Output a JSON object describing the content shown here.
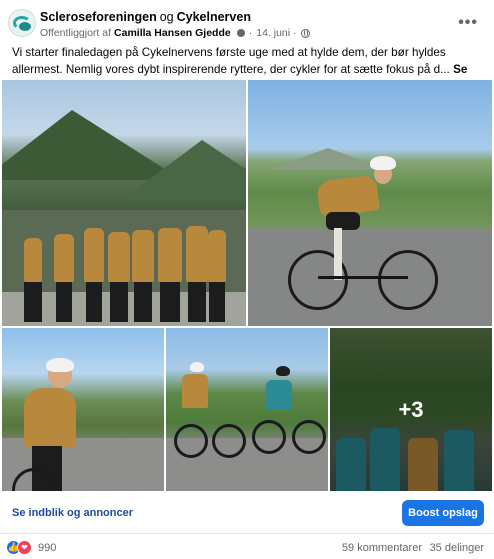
{
  "post": {
    "page_name": "Scleroseforeningen",
    "connector": "og",
    "partner_name": "Cykelnerven",
    "published_by_prefix": "Offentliggjort af",
    "published_by_name": "Camilla Hansen Gjedde",
    "date": "14. juni",
    "text": "Vi starter finaledagen på Cykelnervens første uge med at hylde dem, der bør hyldes allermest. Nemlig vores dybt inspirerende ryttere, der cykler for at sætte fokus på d...",
    "see_more": "Se mere",
    "more_photos_label": "+3"
  },
  "actions": {
    "insights_label": "Se indblik og annoncer",
    "boost_label": "Boost opslag"
  },
  "stats": {
    "reactions_count": "990",
    "comments": "59 kommentarer",
    "shares": "35 delinger"
  },
  "colors": {
    "link_blue": "#1b4d9e",
    "button_blue": "#1b74e4",
    "like_blue": "#1b74e4",
    "heart_red": "#f33e58",
    "brand_teal": "#2aa7a1"
  },
  "icons": {
    "more": "more-options-icon",
    "audience": "globe-icon",
    "like": "like-reaction-icon",
    "love": "love-reaction-icon"
  }
}
